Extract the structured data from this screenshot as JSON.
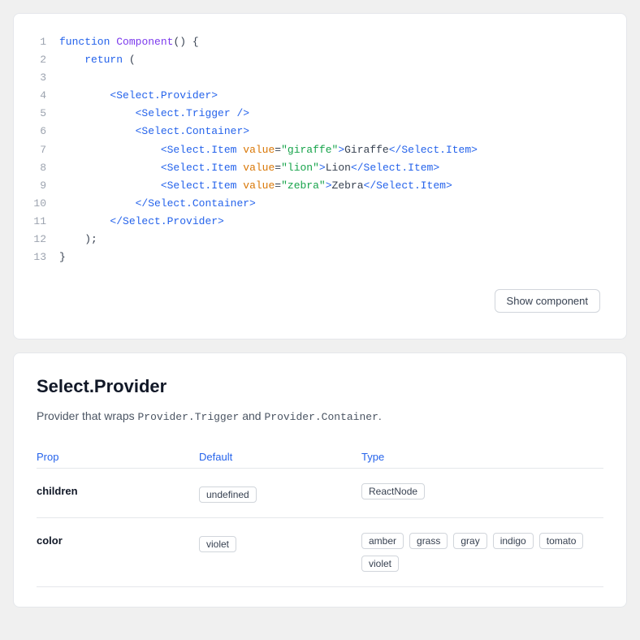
{
  "codeBlock": {
    "lines": [
      {
        "num": 1,
        "tokens": [
          {
            "t": "kw",
            "v": "function"
          },
          {
            "t": "plain",
            "v": " "
          },
          {
            "t": "fn",
            "v": "Component"
          },
          {
            "t": "plain",
            "v": "() {"
          }
        ]
      },
      {
        "num": 2,
        "tokens": [
          {
            "t": "plain",
            "v": "    "
          },
          {
            "t": "kw",
            "v": "return"
          },
          {
            "t": "plain",
            "v": " ("
          }
        ]
      },
      {
        "num": 3,
        "tokens": []
      },
      {
        "num": 4,
        "tokens": [
          {
            "t": "plain",
            "v": "        "
          },
          {
            "t": "tag",
            "v": "<Select.Provider>"
          },
          {
            "t": "plain",
            "v": ""
          }
        ]
      },
      {
        "num": 5,
        "tokens": [
          {
            "t": "plain",
            "v": "            "
          },
          {
            "t": "tag",
            "v": "<Select.Trigger />"
          },
          {
            "t": "plain",
            "v": ""
          }
        ]
      },
      {
        "num": 6,
        "tokens": [
          {
            "t": "plain",
            "v": "            "
          },
          {
            "t": "tag",
            "v": "<Select.Container>"
          },
          {
            "t": "plain",
            "v": ""
          }
        ]
      },
      {
        "num": 7,
        "tokens": [
          {
            "t": "plain",
            "v": "                "
          },
          {
            "t": "tag",
            "v": "<Select.Item"
          },
          {
            "t": "plain",
            "v": " "
          },
          {
            "t": "attr",
            "v": "value"
          },
          {
            "t": "plain",
            "v": "="
          },
          {
            "t": "str",
            "v": "\"giraffe\""
          },
          {
            "t": "tag",
            "v": ">"
          },
          {
            "t": "plain",
            "v": "Giraffe"
          },
          {
            "t": "tag",
            "v": "</Select.Item>"
          }
        ]
      },
      {
        "num": 8,
        "tokens": [
          {
            "t": "plain",
            "v": "                "
          },
          {
            "t": "tag",
            "v": "<Select.Item"
          },
          {
            "t": "plain",
            "v": " "
          },
          {
            "t": "attr",
            "v": "value"
          },
          {
            "t": "plain",
            "v": "="
          },
          {
            "t": "str",
            "v": "\"lion\""
          },
          {
            "t": "tag",
            "v": ">"
          },
          {
            "t": "plain",
            "v": "Lion"
          },
          {
            "t": "tag",
            "v": "</Select.Item>"
          }
        ]
      },
      {
        "num": 9,
        "tokens": [
          {
            "t": "plain",
            "v": "                "
          },
          {
            "t": "tag",
            "v": "<Select.Item"
          },
          {
            "t": "plain",
            "v": " "
          },
          {
            "t": "attr",
            "v": "value"
          },
          {
            "t": "plain",
            "v": "="
          },
          {
            "t": "str",
            "v": "\"zebra\""
          },
          {
            "t": "tag",
            "v": ">"
          },
          {
            "t": "plain",
            "v": "Zebra"
          },
          {
            "t": "tag",
            "v": "</Select.Item>"
          }
        ]
      },
      {
        "num": 10,
        "tokens": [
          {
            "t": "plain",
            "v": "            "
          },
          {
            "t": "tag",
            "v": "</Select.Container>"
          },
          {
            "t": "plain",
            "v": ""
          }
        ]
      },
      {
        "num": 11,
        "tokens": [
          {
            "t": "plain",
            "v": "        "
          },
          {
            "t": "tag",
            "v": "</Select.Provider>"
          },
          {
            "t": "plain",
            "v": ""
          }
        ]
      },
      {
        "num": 12,
        "tokens": [
          {
            "t": "plain",
            "v": "    );"
          },
          {
            "t": "plain",
            "v": ""
          }
        ]
      },
      {
        "num": 13,
        "tokens": [
          {
            "t": "plain",
            "v": "}"
          },
          {
            "t": "plain",
            "v": ""
          }
        ]
      }
    ],
    "showComponentLabel": "Show component"
  },
  "docs": {
    "title": "Select.Provider",
    "description": "Provider that wraps `Provider.Trigger` and `Provider.Container`.",
    "propsTableHeaders": {
      "prop": "Prop",
      "default": "Default",
      "type": "Type"
    },
    "props": [
      {
        "name": "children",
        "default": "undefined",
        "types": [
          "ReactNode"
        ]
      },
      {
        "name": "color",
        "default": "violet",
        "types": [
          "amber",
          "grass",
          "gray",
          "indigo",
          "tomato",
          "violet"
        ]
      }
    ]
  }
}
